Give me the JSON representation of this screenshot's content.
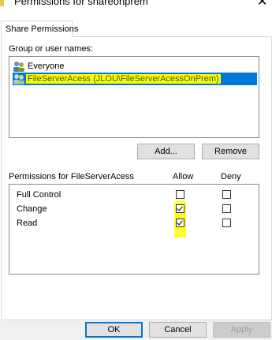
{
  "window": {
    "title": "Permissions for shareonprem"
  },
  "tabs": [
    {
      "label": "Share Permissions"
    }
  ],
  "group_section": {
    "label": "Group or user names:"
  },
  "users": [
    {
      "name": "Everyone",
      "selected": false
    },
    {
      "name": "FileServerAcess (JLOU\\FileServerAcessOnPrem)",
      "selected": true
    }
  ],
  "user_buttons": {
    "add": "Add...",
    "remove": "Remove"
  },
  "permissions": {
    "header_label": "Permissions for FileServerAcess",
    "allow_header": "Allow",
    "deny_header": "Deny",
    "rows": [
      {
        "name": "Full Control",
        "allow": false,
        "deny": false
      },
      {
        "name": "Change",
        "allow": true,
        "deny": false
      },
      {
        "name": "Read",
        "allow": true,
        "deny": false
      }
    ]
  },
  "dialog_buttons": {
    "ok": "OK",
    "cancel": "Cancel",
    "apply": "Apply"
  },
  "colors": {
    "selection": "#0078d7",
    "highlight": "#ffff00"
  }
}
